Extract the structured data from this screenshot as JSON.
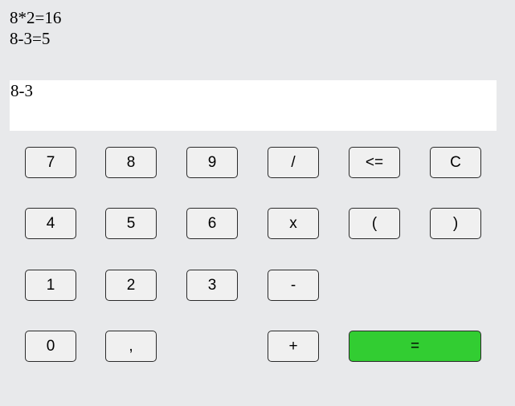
{
  "history": [
    "8*2=16",
    "8-3=5"
  ],
  "display": {
    "value": "8-3"
  },
  "keys": {
    "seven": "7",
    "eight": "8",
    "nine": "9",
    "divide": "/",
    "backspace": "<=",
    "clear": "C",
    "four": "4",
    "five": "5",
    "six": "6",
    "multiply": "x",
    "open_paren": "(",
    "close_paren": ")",
    "one": "1",
    "two": "2",
    "three": "3",
    "minus": "-",
    "zero": "0",
    "comma": ",",
    "plus": "+",
    "equals": "="
  },
  "colors": {
    "equals_button": "#32cd32",
    "background": "#e8e9eb",
    "button": "#f0f0f0"
  }
}
